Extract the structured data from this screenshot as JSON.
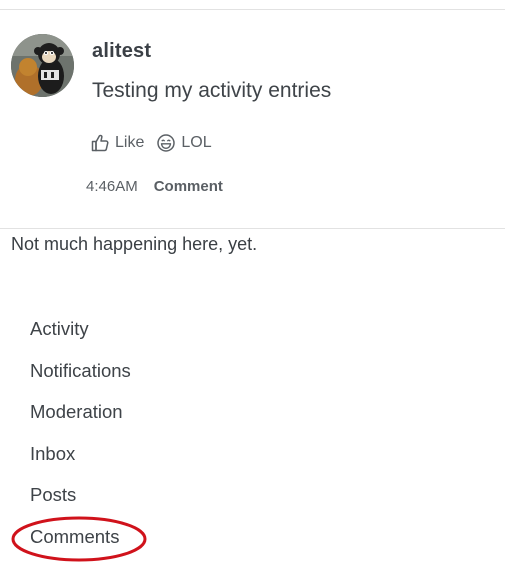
{
  "activity": {
    "username": "alitest",
    "body": "Testing my activity entries",
    "avatar_icon": "monkey-avatar",
    "reactions": [
      {
        "label": "Like",
        "icon": "thumbs-up-icon"
      },
      {
        "label": "LOL",
        "icon": "laughing-face-icon"
      }
    ],
    "timestamp": "4:46AM",
    "comment_label": "Comment"
  },
  "empty_message": "Not much happening here, yet.",
  "nav": {
    "items": [
      {
        "label": "Activity"
      },
      {
        "label": "Notifications"
      },
      {
        "label": "Moderation"
      },
      {
        "label": "Inbox"
      },
      {
        "label": "Posts"
      },
      {
        "label": "Comments",
        "annotated": true
      }
    ]
  },
  "annotation": {
    "color": "#d0121b"
  }
}
